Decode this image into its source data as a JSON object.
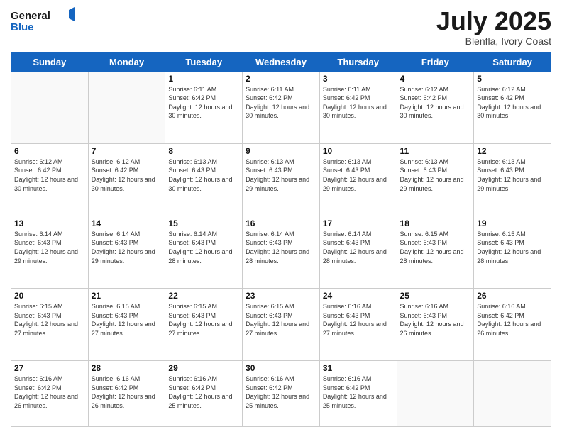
{
  "header": {
    "logo_general": "General",
    "logo_blue": "Blue",
    "month": "July 2025",
    "location": "Blenfla, Ivory Coast"
  },
  "days_of_week": [
    "Sunday",
    "Monday",
    "Tuesday",
    "Wednesday",
    "Thursday",
    "Friday",
    "Saturday"
  ],
  "weeks": [
    [
      {
        "day": "",
        "info": ""
      },
      {
        "day": "",
        "info": ""
      },
      {
        "day": "1",
        "info": "Sunrise: 6:11 AM\nSunset: 6:42 PM\nDaylight: 12 hours and 30 minutes."
      },
      {
        "day": "2",
        "info": "Sunrise: 6:11 AM\nSunset: 6:42 PM\nDaylight: 12 hours and 30 minutes."
      },
      {
        "day": "3",
        "info": "Sunrise: 6:11 AM\nSunset: 6:42 PM\nDaylight: 12 hours and 30 minutes."
      },
      {
        "day": "4",
        "info": "Sunrise: 6:12 AM\nSunset: 6:42 PM\nDaylight: 12 hours and 30 minutes."
      },
      {
        "day": "5",
        "info": "Sunrise: 6:12 AM\nSunset: 6:42 PM\nDaylight: 12 hours and 30 minutes."
      }
    ],
    [
      {
        "day": "6",
        "info": "Sunrise: 6:12 AM\nSunset: 6:42 PM\nDaylight: 12 hours and 30 minutes."
      },
      {
        "day": "7",
        "info": "Sunrise: 6:12 AM\nSunset: 6:42 PM\nDaylight: 12 hours and 30 minutes."
      },
      {
        "day": "8",
        "info": "Sunrise: 6:13 AM\nSunset: 6:43 PM\nDaylight: 12 hours and 30 minutes."
      },
      {
        "day": "9",
        "info": "Sunrise: 6:13 AM\nSunset: 6:43 PM\nDaylight: 12 hours and 29 minutes."
      },
      {
        "day": "10",
        "info": "Sunrise: 6:13 AM\nSunset: 6:43 PM\nDaylight: 12 hours and 29 minutes."
      },
      {
        "day": "11",
        "info": "Sunrise: 6:13 AM\nSunset: 6:43 PM\nDaylight: 12 hours and 29 minutes."
      },
      {
        "day": "12",
        "info": "Sunrise: 6:13 AM\nSunset: 6:43 PM\nDaylight: 12 hours and 29 minutes."
      }
    ],
    [
      {
        "day": "13",
        "info": "Sunrise: 6:14 AM\nSunset: 6:43 PM\nDaylight: 12 hours and 29 minutes."
      },
      {
        "day": "14",
        "info": "Sunrise: 6:14 AM\nSunset: 6:43 PM\nDaylight: 12 hours and 29 minutes."
      },
      {
        "day": "15",
        "info": "Sunrise: 6:14 AM\nSunset: 6:43 PM\nDaylight: 12 hours and 28 minutes."
      },
      {
        "day": "16",
        "info": "Sunrise: 6:14 AM\nSunset: 6:43 PM\nDaylight: 12 hours and 28 minutes."
      },
      {
        "day": "17",
        "info": "Sunrise: 6:14 AM\nSunset: 6:43 PM\nDaylight: 12 hours and 28 minutes."
      },
      {
        "day": "18",
        "info": "Sunrise: 6:15 AM\nSunset: 6:43 PM\nDaylight: 12 hours and 28 minutes."
      },
      {
        "day": "19",
        "info": "Sunrise: 6:15 AM\nSunset: 6:43 PM\nDaylight: 12 hours and 28 minutes."
      }
    ],
    [
      {
        "day": "20",
        "info": "Sunrise: 6:15 AM\nSunset: 6:43 PM\nDaylight: 12 hours and 27 minutes."
      },
      {
        "day": "21",
        "info": "Sunrise: 6:15 AM\nSunset: 6:43 PM\nDaylight: 12 hours and 27 minutes."
      },
      {
        "day": "22",
        "info": "Sunrise: 6:15 AM\nSunset: 6:43 PM\nDaylight: 12 hours and 27 minutes."
      },
      {
        "day": "23",
        "info": "Sunrise: 6:15 AM\nSunset: 6:43 PM\nDaylight: 12 hours and 27 minutes."
      },
      {
        "day": "24",
        "info": "Sunrise: 6:16 AM\nSunset: 6:43 PM\nDaylight: 12 hours and 27 minutes."
      },
      {
        "day": "25",
        "info": "Sunrise: 6:16 AM\nSunset: 6:43 PM\nDaylight: 12 hours and 26 minutes."
      },
      {
        "day": "26",
        "info": "Sunrise: 6:16 AM\nSunset: 6:42 PM\nDaylight: 12 hours and 26 minutes."
      }
    ],
    [
      {
        "day": "27",
        "info": "Sunrise: 6:16 AM\nSunset: 6:42 PM\nDaylight: 12 hours and 26 minutes."
      },
      {
        "day": "28",
        "info": "Sunrise: 6:16 AM\nSunset: 6:42 PM\nDaylight: 12 hours and 26 minutes."
      },
      {
        "day": "29",
        "info": "Sunrise: 6:16 AM\nSunset: 6:42 PM\nDaylight: 12 hours and 25 minutes."
      },
      {
        "day": "30",
        "info": "Sunrise: 6:16 AM\nSunset: 6:42 PM\nDaylight: 12 hours and 25 minutes."
      },
      {
        "day": "31",
        "info": "Sunrise: 6:16 AM\nSunset: 6:42 PM\nDaylight: 12 hours and 25 minutes."
      },
      {
        "day": "",
        "info": ""
      },
      {
        "day": "",
        "info": ""
      }
    ]
  ]
}
